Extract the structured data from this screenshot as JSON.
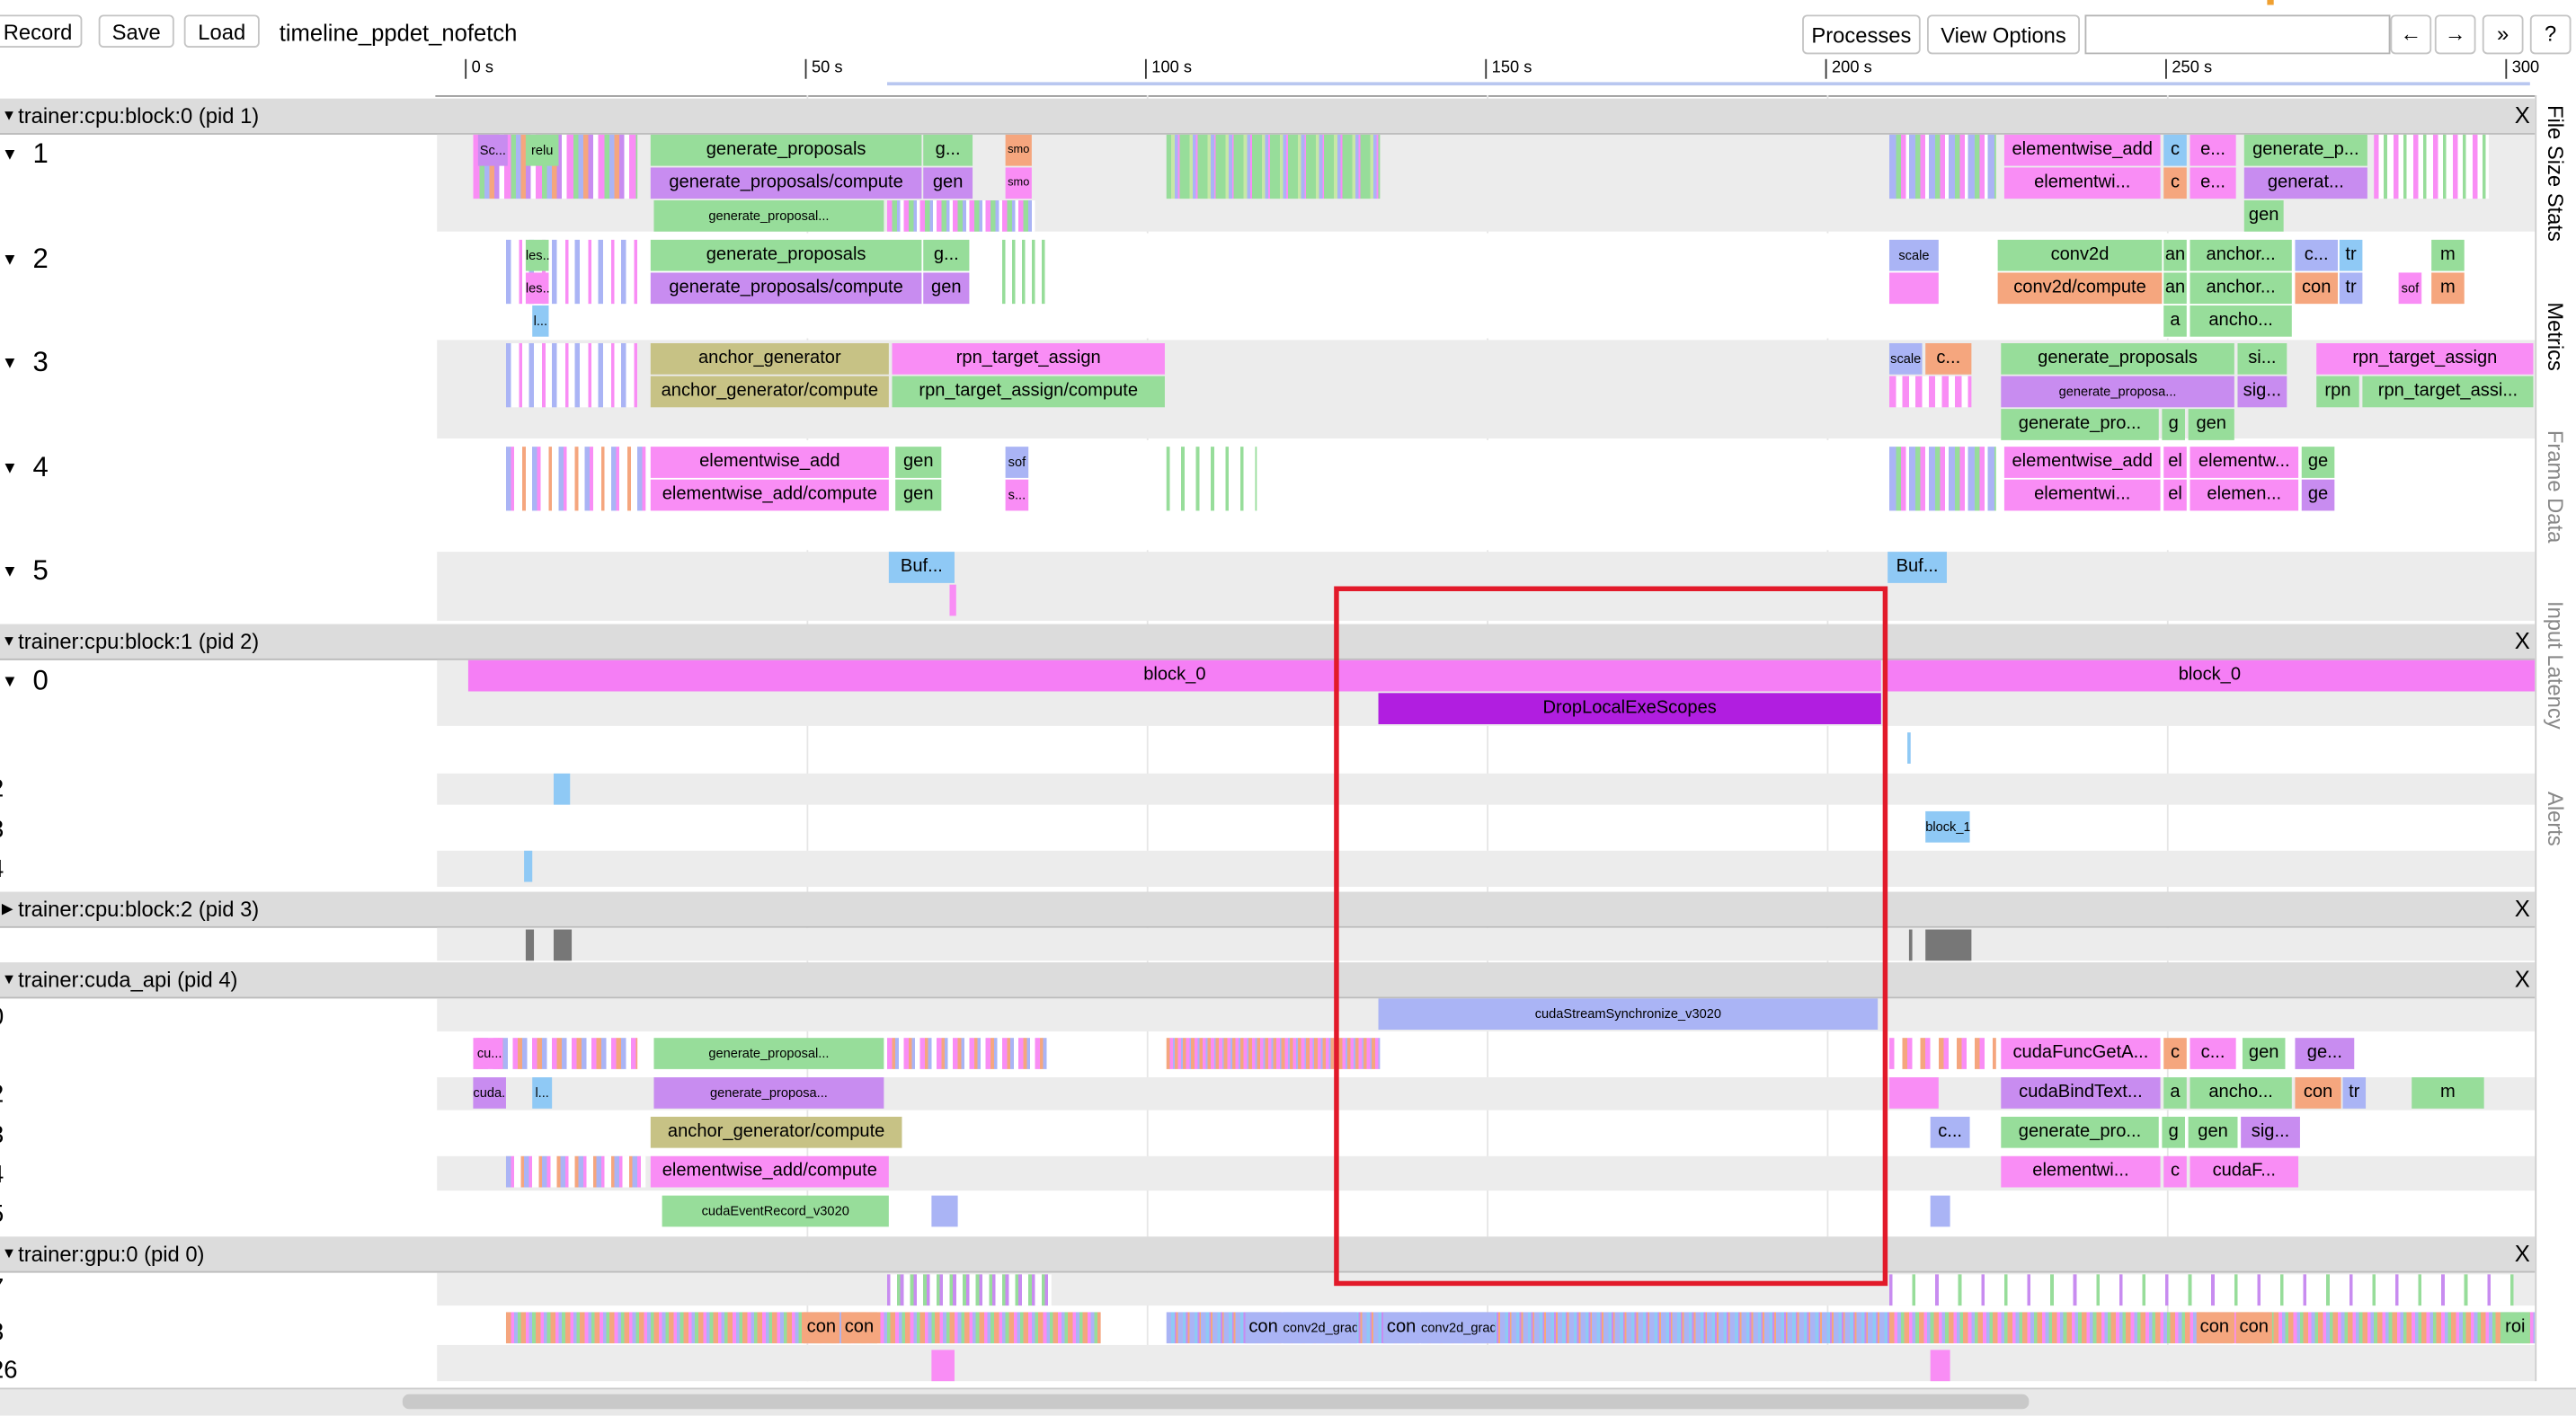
{
  "toolbar": {
    "record_label": "Record",
    "save_label": "Save",
    "load_label": "Load",
    "trace_title": "timeline_ppdet_nofetch",
    "processes_label": "Processes",
    "view_options_label": "View Options",
    "search_value": "",
    "nav_left": "←",
    "nav_right": "→",
    "expand": "»",
    "help": "?"
  },
  "ruler": {
    "ticks": [
      "0 s",
      "50 s",
      "100 s",
      "150 s",
      "200 s",
      "250 s",
      "300"
    ]
  },
  "processes": [
    {
      "label": "trainer:cpu:block:0 (pid 1)",
      "close": "X"
    },
    {
      "label": "trainer:cpu:block:1 (pid 2)",
      "close": "X"
    },
    {
      "label": "trainer:cpu:block:2 (pid 3)",
      "close": "X"
    },
    {
      "label": "trainer:cuda_api (pid 4)",
      "close": "X"
    },
    {
      "label": "trainer:gpu:0 (pid 0)",
      "close": "X"
    }
  ],
  "threads": {
    "p1": [
      "1",
      "2",
      "3",
      "4",
      "5"
    ],
    "p2": [
      "0",
      "2",
      "3",
      "4"
    ],
    "p4": [
      "0",
      "2",
      "3",
      "4",
      "5"
    ],
    "p0": [
      "7",
      "3",
      "26"
    ]
  },
  "slices": {
    "s1a": "generate_proposals",
    "s1b": "g...",
    "s1c": "generate_proposals/compute",
    "s1d": "gen",
    "s1e": "generate_proposal...",
    "s1f": "elementwise_add",
    "s1g": "c",
    "s1h": "e...",
    "s1i": "generate_p...",
    "s1j": "elementwi...",
    "s1k": "c",
    "s1l": "e...",
    "s1m": "generat...",
    "s1n": "gen",
    "s1o": "Sc...",
    "s1p": "relu",
    "s1q": "smo",
    "s1r": "smo",
    "s2a": "generate_proposals",
    "s2b": "g...",
    "s2c": "generate_proposals/compute",
    "s2d": "gen",
    "s2e": "conv2d",
    "s2f": "an",
    "s2g": "anchor...",
    "s2h": "c...",
    "s2i": "tr",
    "s2j": "m",
    "s2k": "conv2d/compute",
    "s2l": "an",
    "s2m": "anchor...",
    "s2n": "con",
    "s2o": "tr",
    "s2p": "sof",
    "s2q": "m",
    "s2r": "a",
    "s2s": "ancho...",
    "s2t": "les...",
    "s2u": "les...",
    "s2v": "l...",
    "s2w": "scale",
    "s3a": "anchor_generator",
    "s3b": "rpn_target_assign",
    "s3c": "anchor_generator/compute",
    "s3d": "rpn_target_assign/compute",
    "s3e": "generate_proposals",
    "s3f": "si...",
    "s3g": "rpn_target_assign",
    "s3h": "generate_proposa...",
    "s3i": "sig...",
    "s3j": "rpn",
    "s3k": "rpn_target_assi...",
    "s3l": "generate_pro...",
    "s3m": "g",
    "s3n": "gen",
    "s3o": "scale",
    "s3p": "c...",
    "s4a": "elementwise_add",
    "s4b": "gen",
    "s4c": "elementwise_add/compute",
    "s4d": "gen",
    "s4e": "sof",
    "s4f": "s...",
    "s4g": "elementwise_add",
    "s4h": "el",
    "s4i": "elementw...",
    "s4j": "ge",
    "s4k": "elementwi...",
    "s4l": "el",
    "s4m": "elemen...",
    "s4n": "ge",
    "s5a": "Buf...",
    "s5b": "Buf...",
    "b0a": "block_0",
    "b0b": "block_0",
    "b0c": "DropLocalExeScopes",
    "b1": "block_1",
    "c0": "cudaStreamSynchronize_v3020",
    "c2a": "cu...",
    "c2b": "generate_proposal...",
    "c2c": "cudaFuncGetA...",
    "c2d": "c",
    "c2e": "c...",
    "c2f": "gen",
    "c2g": "ge...",
    "c3a": "cuda...",
    "c3b": "l...",
    "c3c": "generate_proposa...",
    "c3d": "cudaBindText...",
    "c3e": "a",
    "c3f": "ancho...",
    "c3g": "con",
    "c3h": "tr",
    "c3i": "m",
    "c4a": "anchor_generator/compute",
    "c4b": "c...",
    "c4c": "generate_pro...",
    "c4d": "g",
    "c4e": "gen",
    "c4f": "sig...",
    "c5a": "elementwise_add/compute",
    "c5b": "elementwi...",
    "c5c": "c",
    "c5d": "cudaF...",
    "c6a": "cudaEventRecord_v3020",
    "g3a": "con",
    "g3b": "con",
    "g3c": "con",
    "g3d": "conv2d_grad...",
    "g3e": "con",
    "g3f": "conv2d_grad...",
    "g3g": "con",
    "g3h": "con",
    "g3i": "roi"
  },
  "side_tabs": [
    "File Size Stats",
    "Metrics",
    "Frame Data",
    "Input Latency",
    "Alerts"
  ],
  "colors": {
    "highlight_box": "#e21a2a",
    "pink": "#f57ef5",
    "green": "#97dd9a",
    "purple_op": "#c88cf0",
    "violet": "#b11ee0",
    "lavender": "#aab4f5",
    "blue": "#8fc9f5"
  }
}
